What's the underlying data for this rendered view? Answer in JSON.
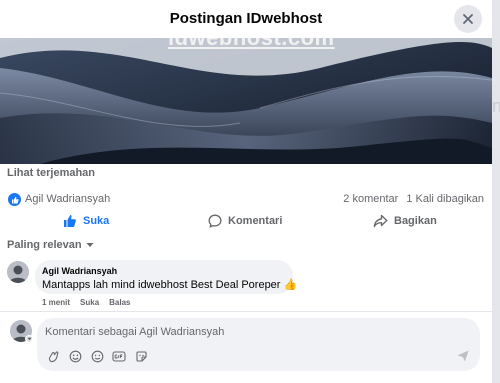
{
  "header": {
    "title": "Postingan IDwebhost"
  },
  "hero": {
    "overlay_text": "idwebhost.com"
  },
  "post": {
    "see_translation": "Lihat terjemahan"
  },
  "reactions": {
    "reactor_name": "Agil Wadriansyah",
    "comment_count": "2 komentar",
    "share_count": "1 Kali dibagikan"
  },
  "actions": {
    "like": "Suka",
    "comment": "Komentari",
    "share": "Bagikan"
  },
  "sort": {
    "label": "Paling relevan"
  },
  "comment": {
    "author": "Agil Wadriansyah",
    "text": "Mantapps lah mind idwebhost Best Deal Poreper",
    "emoji": "👍",
    "time": "1 menit",
    "like": "Suka",
    "reply": "Balas"
  },
  "composer": {
    "placeholder": "Komentari sebagai Agil Wadriansyah"
  },
  "colors": {
    "accent": "#1877f2",
    "muted": "#65676b",
    "bubble": "#f0f2f5"
  },
  "icons": [
    "close-icon",
    "like-icon",
    "comment-icon",
    "share-icon",
    "chevron-down-icon",
    "avatar-sticker-icon",
    "gif-icon",
    "emoji-icon",
    "camera-icon",
    "sticker-icon",
    "send-icon"
  ]
}
